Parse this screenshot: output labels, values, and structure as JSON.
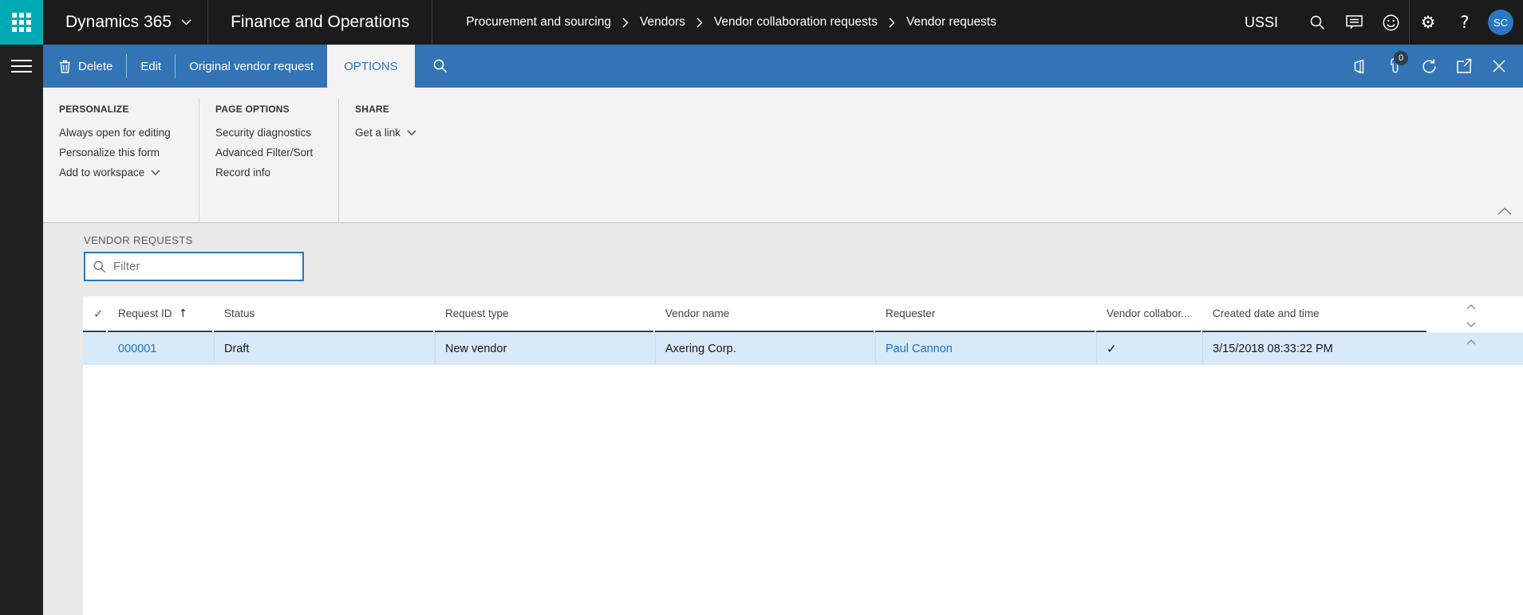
{
  "colors": {
    "accent": "#3374b5",
    "launcher_teal": "#00aab4",
    "link_blue": "#1b74c4",
    "selected_row": "#d8e9f8",
    "topbar_bg": "#1b1b1b"
  },
  "topbar": {
    "product": "Dynamics 365",
    "module": "Finance and Operations",
    "breadcrumb": [
      "Procurement and sourcing",
      "Vendors",
      "Vendor collaboration requests",
      "Vendor requests"
    ],
    "company": "USSI",
    "help_label": "?",
    "avatar_initials": "SC"
  },
  "action_bar": {
    "delete_label": "Delete",
    "edit_label": "Edit",
    "original_vendor_request_label": "Original vendor request",
    "options_tab_label": "OPTIONS",
    "attachments_badge": "0"
  },
  "options_panel": {
    "groups": [
      {
        "title": "PERSONALIZE",
        "items": [
          "Always open for editing",
          "Personalize this form",
          "Add to workspace"
        ]
      },
      {
        "title": "PAGE OPTIONS",
        "items": [
          "Security diagnostics",
          "Advanced Filter/Sort",
          "Record info"
        ]
      },
      {
        "title": "SHARE",
        "items": [
          "Get a link"
        ]
      }
    ]
  },
  "content": {
    "section_title": "VENDOR REQUESTS",
    "filter_placeholder": "Filter",
    "table": {
      "columns": [
        "Request ID",
        "Status",
        "Request type",
        "Vendor name",
        "Requester",
        "Vendor collabor...",
        "Created date and time"
      ],
      "sort_indicator": "↑",
      "header_select_glyph": "✓",
      "rows": [
        {
          "request_id": "000001",
          "status": "Draft",
          "request_type": "New vendor",
          "vendor_name": "Axering Corp.",
          "requester": "Paul Cannon",
          "vendor_collaboration": "✓",
          "created": "3/15/2018 08:33:22 PM"
        }
      ]
    }
  }
}
